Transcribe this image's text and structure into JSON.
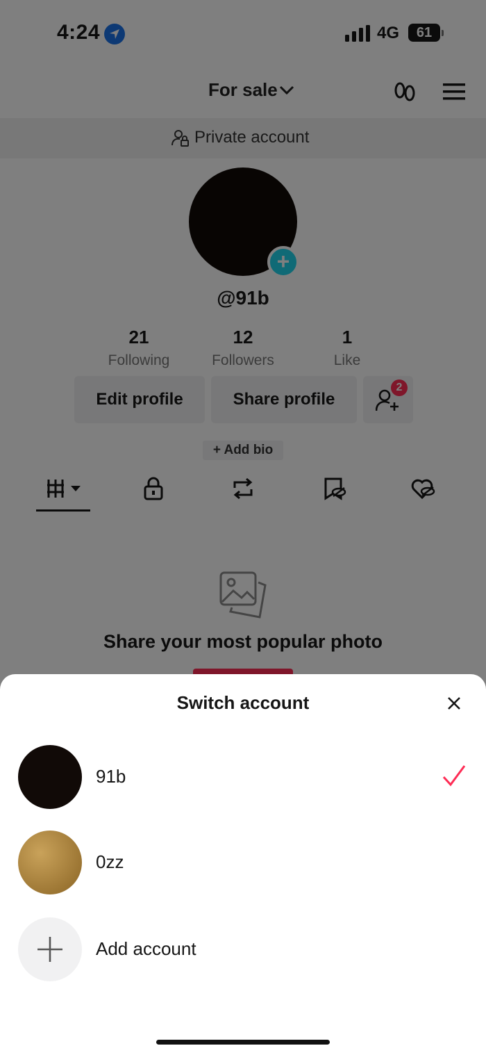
{
  "status_bar": {
    "time": "4:24",
    "network": "4G",
    "battery": "61"
  },
  "top_bar": {
    "title": "For sale"
  },
  "privacy": {
    "label": "Private account"
  },
  "profile": {
    "handle": "@91b",
    "stats": [
      {
        "value": "21",
        "label": "Following"
      },
      {
        "value": "12",
        "label": "Followers"
      },
      {
        "value": "1",
        "label": "Like"
      }
    ],
    "edit_profile_label": "Edit profile",
    "share_profile_label": "Share profile",
    "friend_requests_badge": "2",
    "add_bio_label": "+ Add bio"
  },
  "tabs": [
    "videos-grid-icon",
    "lock-icon",
    "repost-icon",
    "bookmark-hidden-icon",
    "liked-hidden-icon"
  ],
  "empty_state": {
    "title": "Share your most popular photo"
  },
  "sheet": {
    "title": "Switch account",
    "accounts": [
      {
        "name": "91b",
        "selected": true,
        "avatar_color": "#110a07"
      },
      {
        "name": "0zz",
        "selected": false,
        "avatar_color": "#a8813e"
      }
    ],
    "add_account_label": "Add account"
  },
  "colors": {
    "accent": "#fe2c55",
    "teal": "#20d5ec"
  }
}
